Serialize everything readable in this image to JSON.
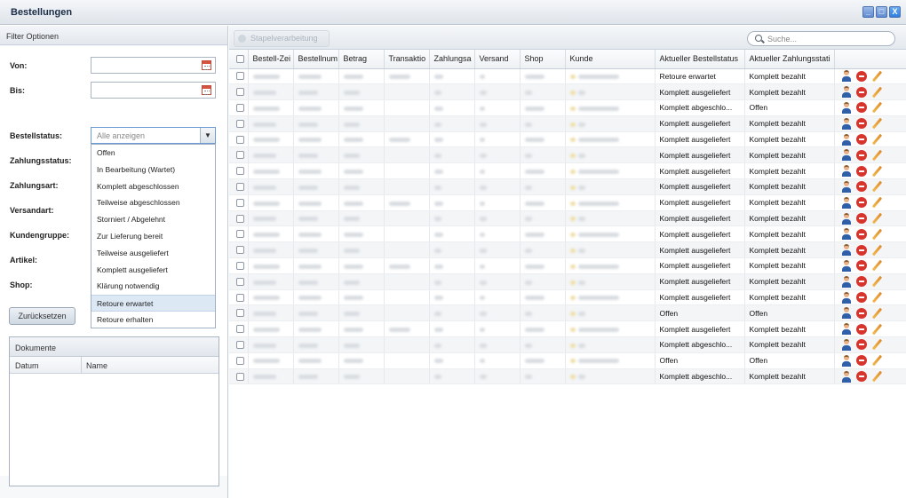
{
  "window": {
    "title": "Bestellungen",
    "buttons": [
      "_",
      "□",
      "X"
    ]
  },
  "filters": {
    "header": "Filter Optionen",
    "von_label": "Von:",
    "bis_label": "Bis:",
    "bestellstatus_label": "Bestellstatus:",
    "bestellstatus_value": "Alle anzeigen",
    "zahlungsstatus_label": "Zahlungsstatus:",
    "zahlungsart_label": "Zahlungsart:",
    "versandart_label": "Versandart:",
    "kundengruppe_label": "Kundengruppe:",
    "artikel_label": "Artikel:",
    "shop_label": "Shop:",
    "dropdown_options": [
      "Offen",
      "In Bearbeitung (Wartet)",
      "Komplett abgeschlossen",
      "Teilweise abgeschlossen",
      "Storniert / Abgelehnt",
      "Zur Lieferung bereit",
      "Teilweise ausgeliefert",
      "Komplett ausgeliefert",
      "Klärung notwendig",
      "Retoure erwartet",
      "Retoure erhalten"
    ],
    "dropdown_selected": "Retoure erwartet",
    "reset_label": "Zurücksetzen"
  },
  "documents": {
    "title": "Dokumente",
    "columns": [
      "Datum",
      "Name"
    ]
  },
  "toolbar": {
    "batch_label": "Stapelverarbeitung",
    "search_placeholder": "Suche..."
  },
  "table": {
    "columns": [
      "Bestell-Zei",
      "Bestellnum",
      "Betrag",
      "Transaktio",
      "Zahlungsa",
      "Versand",
      "Shop",
      "Kunde",
      "Aktueller Bestellstatus",
      "Aktueller Zahlungsstati"
    ],
    "rows": [
      {
        "order_status": "Retoure erwartet",
        "payment_status": "Komplett bezahlt"
      },
      {
        "order_status": "Komplett ausgeliefert",
        "payment_status": "Komplett bezahlt"
      },
      {
        "order_status": "Komplett abgeschlo...",
        "payment_status": "Offen"
      },
      {
        "order_status": "Komplett ausgeliefert",
        "payment_status": "Komplett bezahlt"
      },
      {
        "order_status": "Komplett ausgeliefert",
        "payment_status": "Komplett bezahlt"
      },
      {
        "order_status": "Komplett ausgeliefert",
        "payment_status": "Komplett bezahlt"
      },
      {
        "order_status": "Komplett ausgeliefert",
        "payment_status": "Komplett bezahlt"
      },
      {
        "order_status": "Komplett ausgeliefert",
        "payment_status": "Komplett bezahlt"
      },
      {
        "order_status": "Komplett ausgeliefert",
        "payment_status": "Komplett bezahlt"
      },
      {
        "order_status": "Komplett ausgeliefert",
        "payment_status": "Komplett bezahlt"
      },
      {
        "order_status": "Komplett ausgeliefert",
        "payment_status": "Komplett bezahlt"
      },
      {
        "order_status": "Komplett ausgeliefert",
        "payment_status": "Komplett bezahlt"
      },
      {
        "order_status": "Komplett ausgeliefert",
        "payment_status": "Komplett bezahlt"
      },
      {
        "order_status": "Komplett ausgeliefert",
        "payment_status": "Komplett bezahlt"
      },
      {
        "order_status": "Komplett ausgeliefert",
        "payment_status": "Komplett bezahlt"
      },
      {
        "order_status": "Offen",
        "payment_status": "Offen"
      },
      {
        "order_status": "Komplett ausgeliefert",
        "payment_status": "Komplett bezahlt"
      },
      {
        "order_status": "Komplett abgeschlo...",
        "payment_status": "Komplett bezahlt"
      },
      {
        "order_status": "Offen",
        "payment_status": "Offen"
      },
      {
        "order_status": "Komplett abgeschlo...",
        "payment_status": "Komplett bezahlt"
      }
    ],
    "row_icons": [
      "user-icon",
      "delete-icon",
      "edit-icon"
    ]
  }
}
